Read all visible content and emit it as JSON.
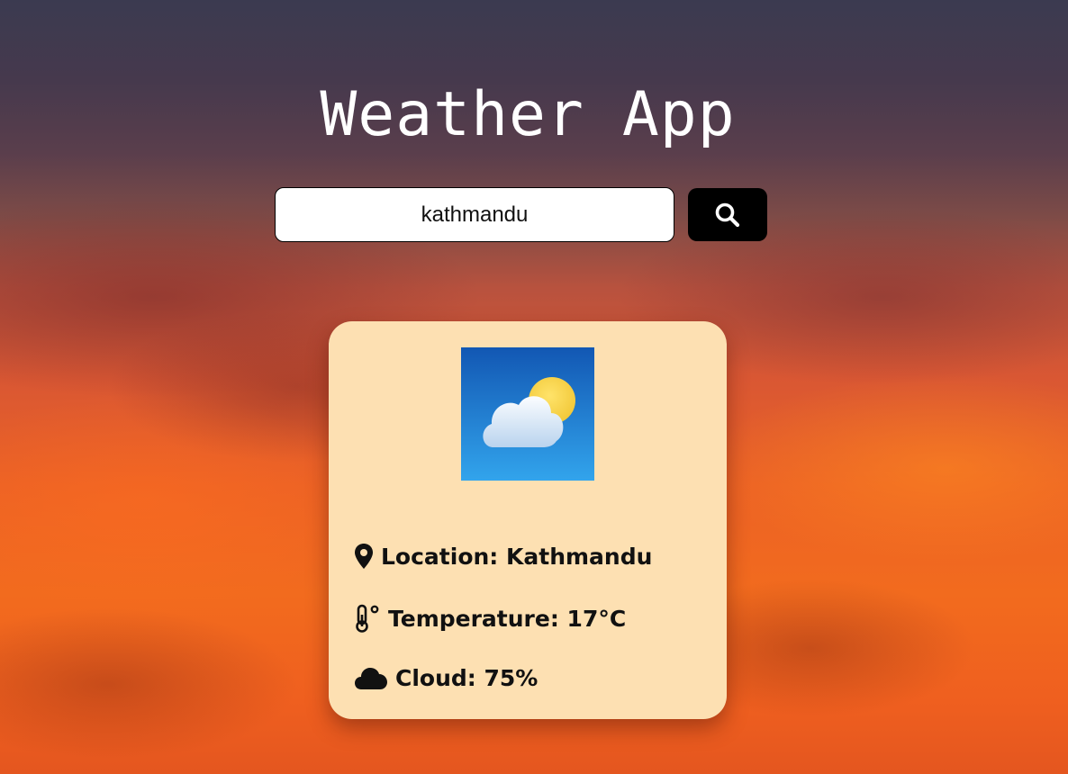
{
  "app": {
    "title": "Weather App"
  },
  "search": {
    "value": "kathmandu",
    "button_icon": "search-icon"
  },
  "weather_card": {
    "condition_icon": "partly-cloudy-icon",
    "location_label": "Location:",
    "location_value": "Kathmandu",
    "location_icon": "map-pin-icon",
    "temperature_label": "Temperature:",
    "temperature_value": "17°C",
    "temperature_icon": "thermometer-icon",
    "cloud_label": "Cloud:",
    "cloud_value": "75%",
    "cloud_icon": "cloud-icon"
  },
  "colors": {
    "card_background": "#fde0b2",
    "button_background": "#000000",
    "title_color": "#ffffff"
  }
}
